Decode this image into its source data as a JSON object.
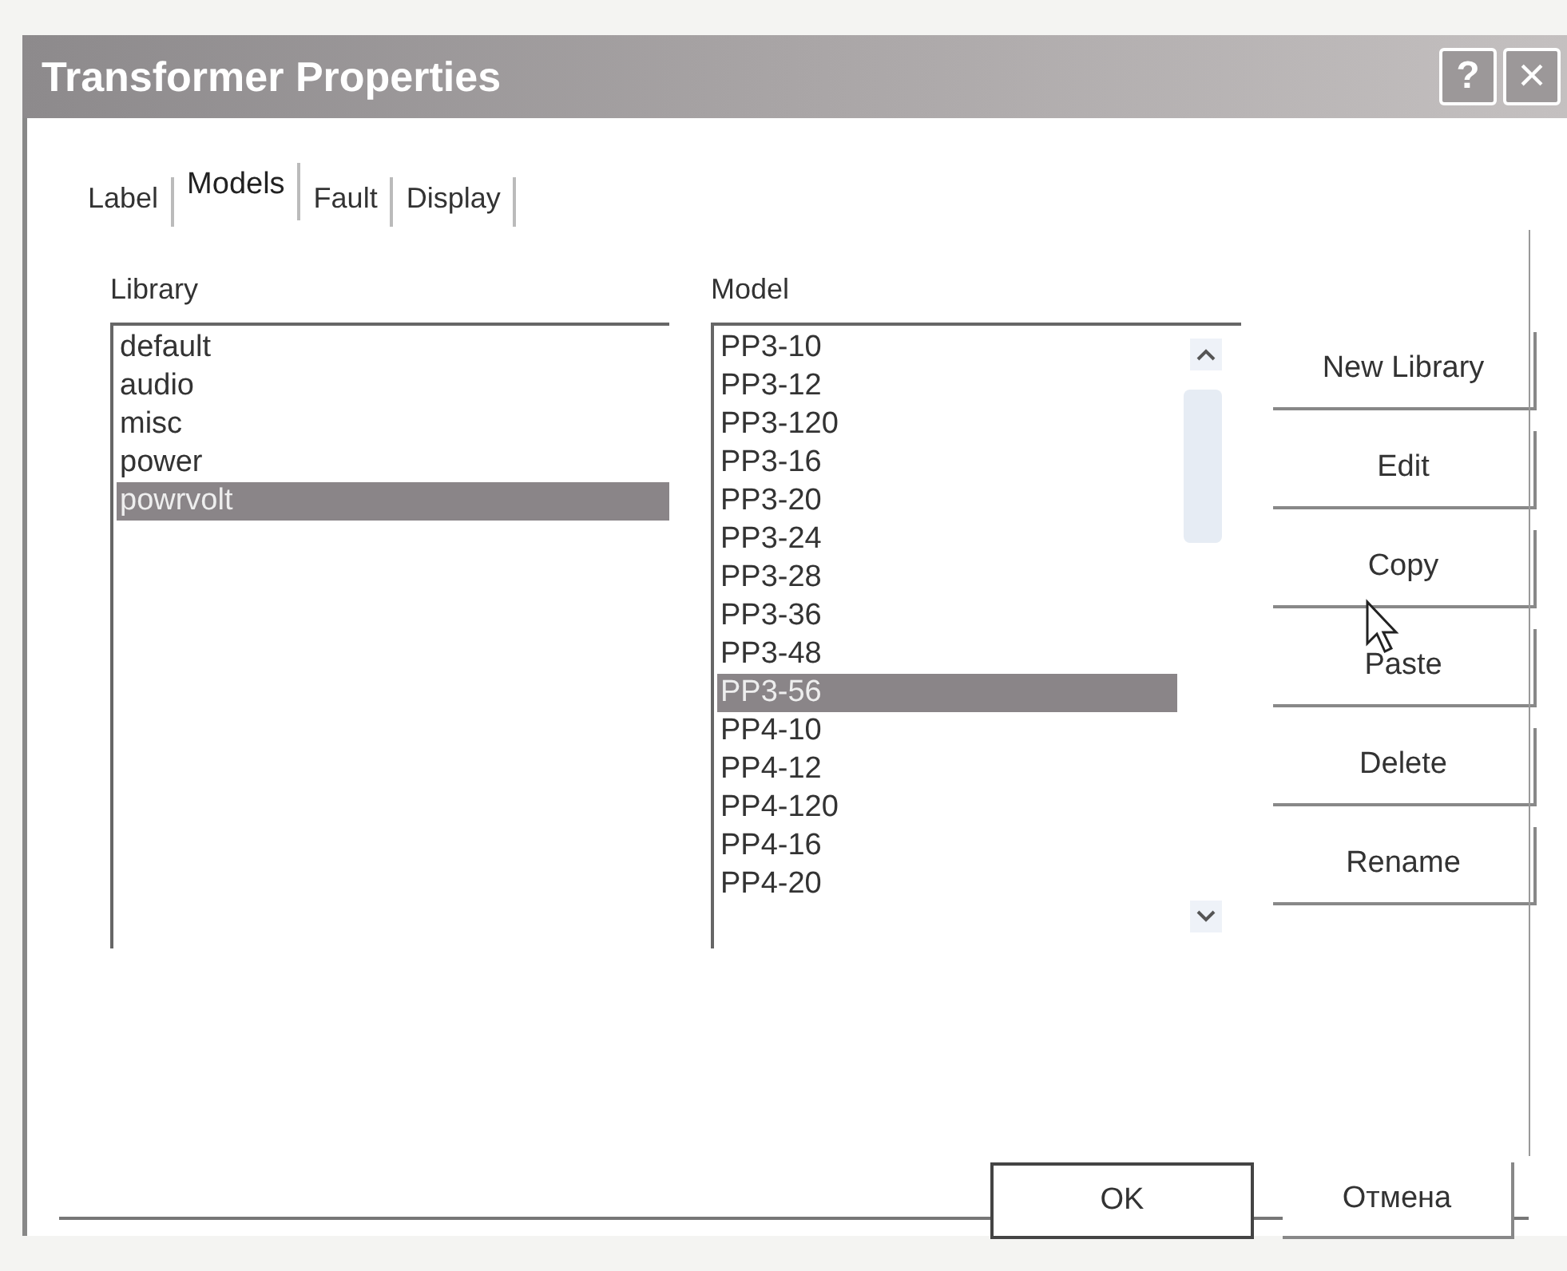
{
  "window": {
    "title": "Transformer Properties",
    "help_button": "?",
    "close_button": "×"
  },
  "tabs": [
    {
      "label": "Label",
      "selected": false
    },
    {
      "label": "Models",
      "selected": true
    },
    {
      "label": "Fault",
      "selected": false
    },
    {
      "label": "Display",
      "selected": false
    }
  ],
  "library": {
    "label": "Library",
    "items": [
      {
        "text": "default",
        "selected": false
      },
      {
        "text": "audio",
        "selected": false
      },
      {
        "text": "misc",
        "selected": false
      },
      {
        "text": "power",
        "selected": false
      },
      {
        "text": "powrvolt",
        "selected": true
      }
    ]
  },
  "model": {
    "label": "Model",
    "items": [
      {
        "text": "PP3-10",
        "selected": false
      },
      {
        "text": "PP3-12",
        "selected": false
      },
      {
        "text": "PP3-120",
        "selected": false
      },
      {
        "text": "PP3-16",
        "selected": false
      },
      {
        "text": "PP3-20",
        "selected": false
      },
      {
        "text": "PP3-24",
        "selected": false
      },
      {
        "text": "PP3-28",
        "selected": false
      },
      {
        "text": "PP3-36",
        "selected": false
      },
      {
        "text": "PP3-48",
        "selected": false
      },
      {
        "text": "PP3-56",
        "selected": true
      },
      {
        "text": "PP4-10",
        "selected": false
      },
      {
        "text": "PP4-12",
        "selected": false
      },
      {
        "text": "PP4-120",
        "selected": false
      },
      {
        "text": "PP4-16",
        "selected": false
      },
      {
        "text": "PP4-20",
        "selected": false
      }
    ]
  },
  "side_buttons": [
    "New Library",
    "Edit",
    "Copy",
    "Paste",
    "Delete",
    "Rename"
  ],
  "footer_buttons": [
    {
      "label": "OK",
      "default": true
    },
    {
      "label": "Отмена",
      "default": false
    }
  ]
}
